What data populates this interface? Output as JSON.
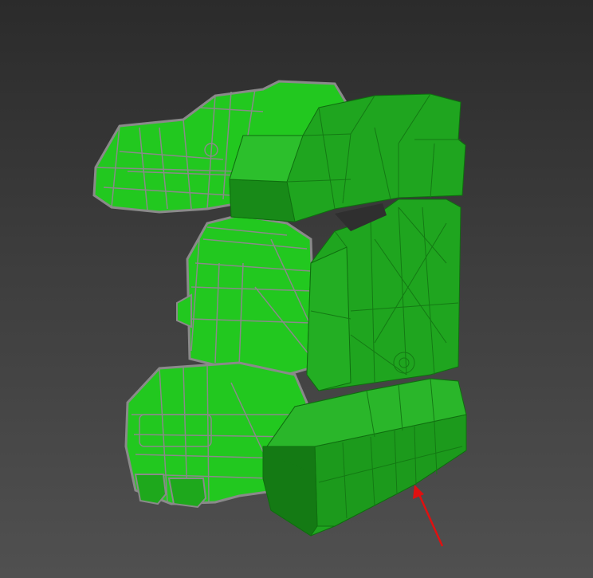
{
  "viewport": {
    "background_top": "#2b2b2b",
    "background_bottom": "#505050"
  },
  "model": {
    "selected_object": "green-mesh-part",
    "background_object": "green-wireframe-model",
    "selected_fill": "#1fa51f",
    "selected_fill_light": "#2cbf2c",
    "selected_fill_dark": "#147a14",
    "wireframe_fill": "#22c81f",
    "wireframe_edges": "#8a8a8a",
    "edges_faces": true
  },
  "annotation": {
    "type": "arrow",
    "color": "#e01010",
    "icon": "arrow-icon"
  }
}
